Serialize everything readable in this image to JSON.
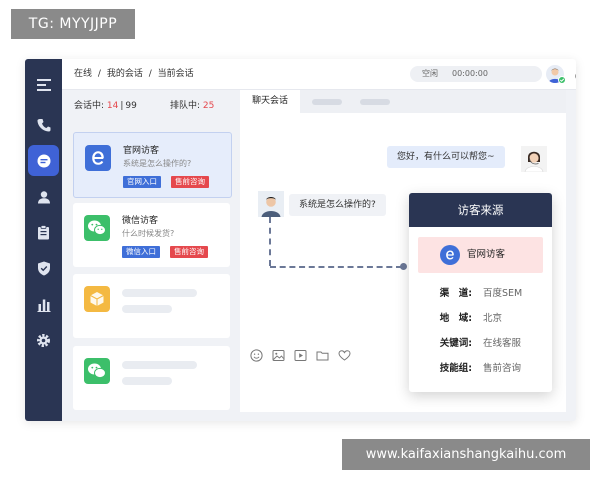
{
  "watermark": {
    "top_left": "TG: MYYJJPP",
    "bottom_right": "www.kaifaxianshangkaihu.com"
  },
  "topbar": {
    "breadcrumb": [
      "在线",
      "我的会话",
      "当前会话"
    ],
    "breadcrumb_sep": "/",
    "status_label": "空闲",
    "timer": "00:00:00"
  },
  "sidebar": {
    "items": [
      {
        "icon": "menu-icon"
      },
      {
        "icon": "phone-icon"
      },
      {
        "icon": "chat-icon",
        "active": true
      },
      {
        "icon": "user-icon"
      },
      {
        "icon": "clipboard-icon"
      },
      {
        "icon": "shield-icon"
      },
      {
        "icon": "bar-chart-icon"
      },
      {
        "icon": "gear-icon"
      }
    ]
  },
  "sessions": {
    "in_session_label": "会话中:",
    "in_session_count": "14",
    "in_session_sep": "|",
    "in_session_total": "99",
    "queue_label": "排队中:",
    "queue_count": "25",
    "cards": [
      {
        "icon": "ie-icon",
        "title": "官网访客",
        "subtitle": "系统是怎么操作的?",
        "tags": [
          "官网入口",
          "售前咨询"
        ]
      },
      {
        "icon": "wechat-icon",
        "title": "微信访客",
        "subtitle": "什么时候发货?",
        "tags": [
          "微信入口",
          "售前咨询"
        ]
      }
    ]
  },
  "chat": {
    "tab_label": "聊天会话",
    "agent_message": "您好，有什么可以帮您~",
    "visitor_message": "系统是怎么操作的?"
  },
  "visitor_source": {
    "title": "访客来源",
    "source": "官网访客",
    "rows": [
      {
        "key": "渠　道:",
        "value": "百度SEM"
      },
      {
        "key": "地　域:",
        "value": "北京"
      },
      {
        "key": "关键词:",
        "value": "在线客服"
      },
      {
        "key": "技能组:",
        "value": "售前咨询"
      }
    ]
  },
  "colors": {
    "sidebar": "#2a3553",
    "accent": "#3f62d6",
    "tag_blue": "#3f6fd8",
    "tag_red": "#e5484d",
    "wechat": "#3cbf6a",
    "box": "#f4b942"
  }
}
